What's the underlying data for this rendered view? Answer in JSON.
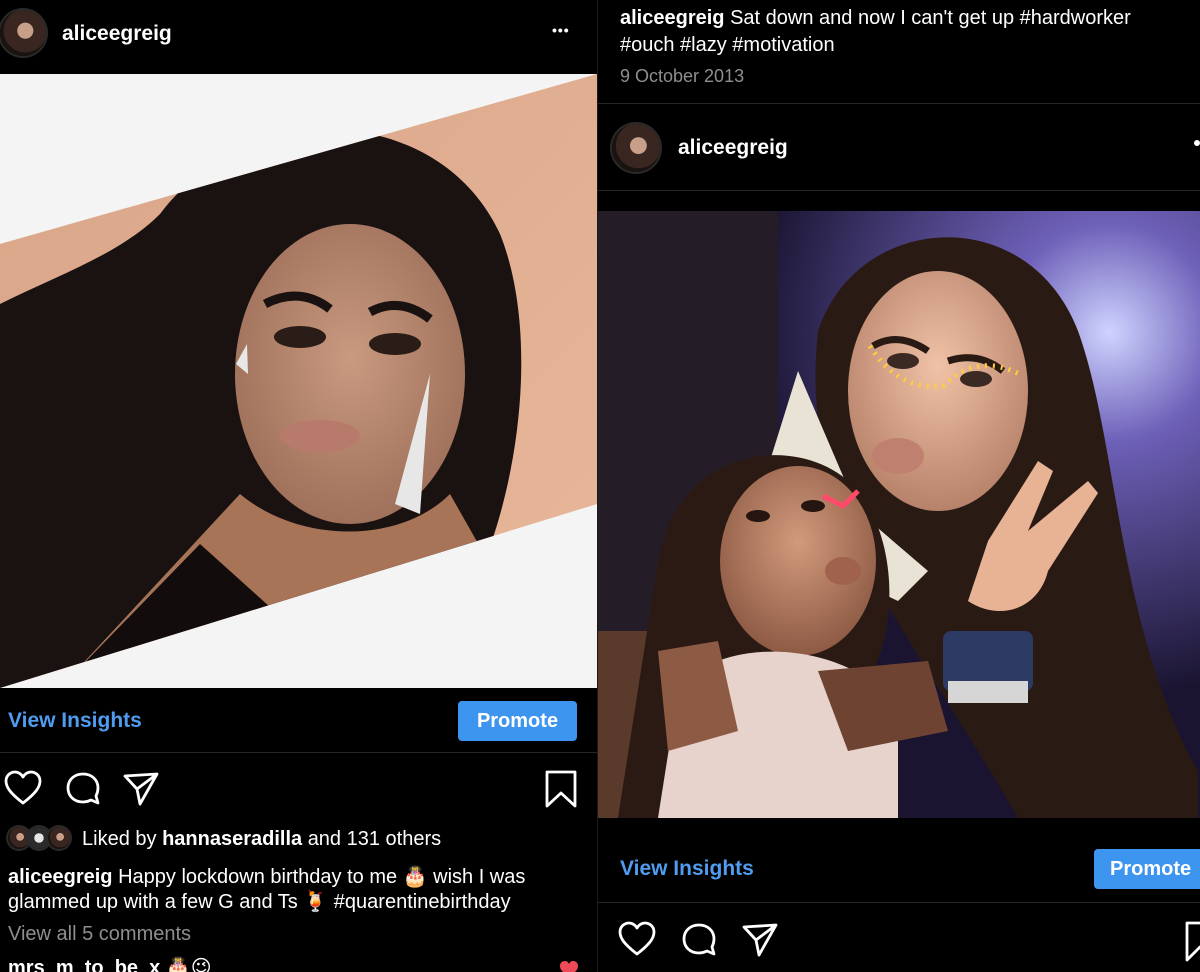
{
  "left_post": {
    "username": "aliceegreig",
    "more_label": "•••",
    "view_insights": "View Insights",
    "promote": "Promote",
    "liked_prefix": "Liked by",
    "liked_user": "hannaseradilla",
    "liked_suffix": "and 131 others",
    "caption_user": "aliceegreig",
    "caption_line1": "Happy lockdown birthday to me 🎂 wish I was",
    "caption_line2": "glammed up with a few G and Ts 🍹 #quarentinebirthday",
    "view_comments": "View all 5 comments",
    "comment_preview": "mrs_m_to_be_x 🎂😉"
  },
  "right_post": {
    "caption_user": "aliceegreig",
    "caption_line1": "Sat down and now I can't get up #hardworker",
    "caption_line2": "#ouch #lazy #motivation",
    "date": "9 October 2013",
    "username": "aliceegreig",
    "view_insights": "View Insights",
    "promote": "Promote"
  },
  "colors": {
    "accent_blue": "#3d95ef",
    "link_blue": "#4f9cf0",
    "muted": "#8e8e8e",
    "like_red": "#ed4956"
  },
  "icons": [
    "heart-icon",
    "comment-icon",
    "share-icon",
    "bookmark-icon",
    "more-icon"
  ]
}
